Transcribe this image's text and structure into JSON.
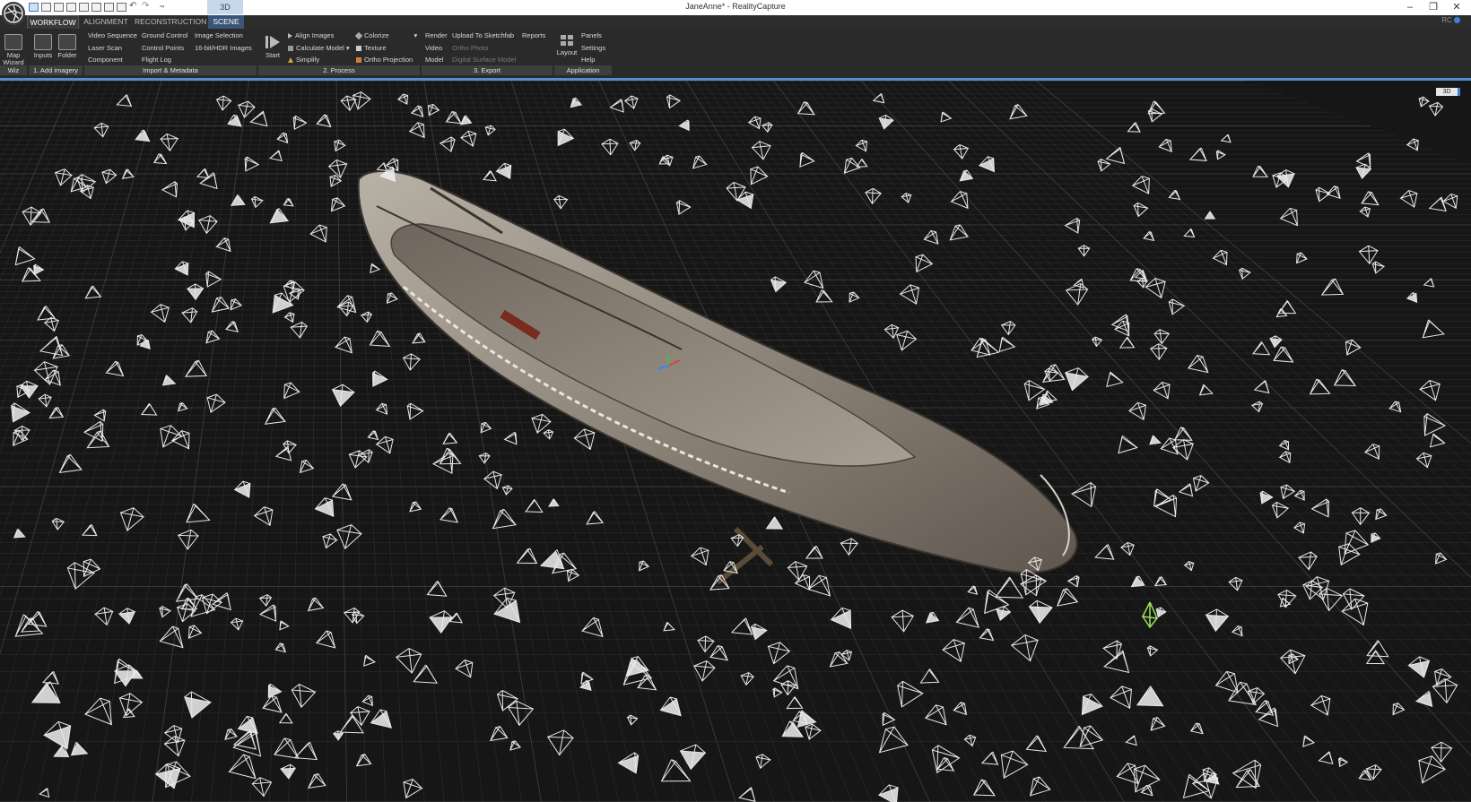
{
  "window": {
    "title": "JaneAnne* - RealityCapture",
    "tab_3d": "3D",
    "controls": [
      "–",
      "❐",
      "✕"
    ],
    "rc_label": "RC"
  },
  "ribbon_tabs": [
    {
      "label": "WORKFLOW"
    },
    {
      "label": "ALIGNMENT"
    },
    {
      "label": "RECONSTRUCTION"
    },
    {
      "label": "SCENE"
    }
  ],
  "ribbon": {
    "wiz": {
      "map_wizard": "Map Wizard",
      "group": "Wiz"
    },
    "add_imagery": {
      "inputs": "Inputs",
      "folder": "Folder",
      "group": "1. Add imagery"
    },
    "import_metadata": {
      "video_sequence": "Video Sequence",
      "laser_scan": "Laser Scan",
      "component": "Component",
      "ground_control": "Ground Control",
      "control_points": "Control Points",
      "flight_log": "Flight Log",
      "image_selection": "Image Selection",
      "hdr_images": "16-bit/HDR Images",
      "group": "Import & Metadata"
    },
    "process": {
      "start": "Start",
      "align_images": "Align Images",
      "calculate_model": "Calculate Model",
      "simplify": "Simplify",
      "colorize": "Colorize",
      "texture": "Texture",
      "ortho_projection": "Ortho Projection",
      "group": "2. Process"
    },
    "export": {
      "render": "Render",
      "video": "Video",
      "model": "Model",
      "upload_sketchfab": "Upload To Sketchfab",
      "ortho_photo": "Ortho Photo",
      "dsm": "Digital Surface Model",
      "reports": "Reports",
      "group": "3. Export"
    },
    "application": {
      "layout": "Layout",
      "panels": "Panels",
      "settings": "Settings",
      "help": "Help",
      "group": "Application"
    }
  },
  "viewport": {
    "badge": "3D",
    "colors": {
      "grid": "#5a5a5a",
      "camera": "#e8e8e8",
      "selected_camera": "#9be15a",
      "hull": "#9a8f82",
      "accent": "#4f8ed6"
    }
  }
}
